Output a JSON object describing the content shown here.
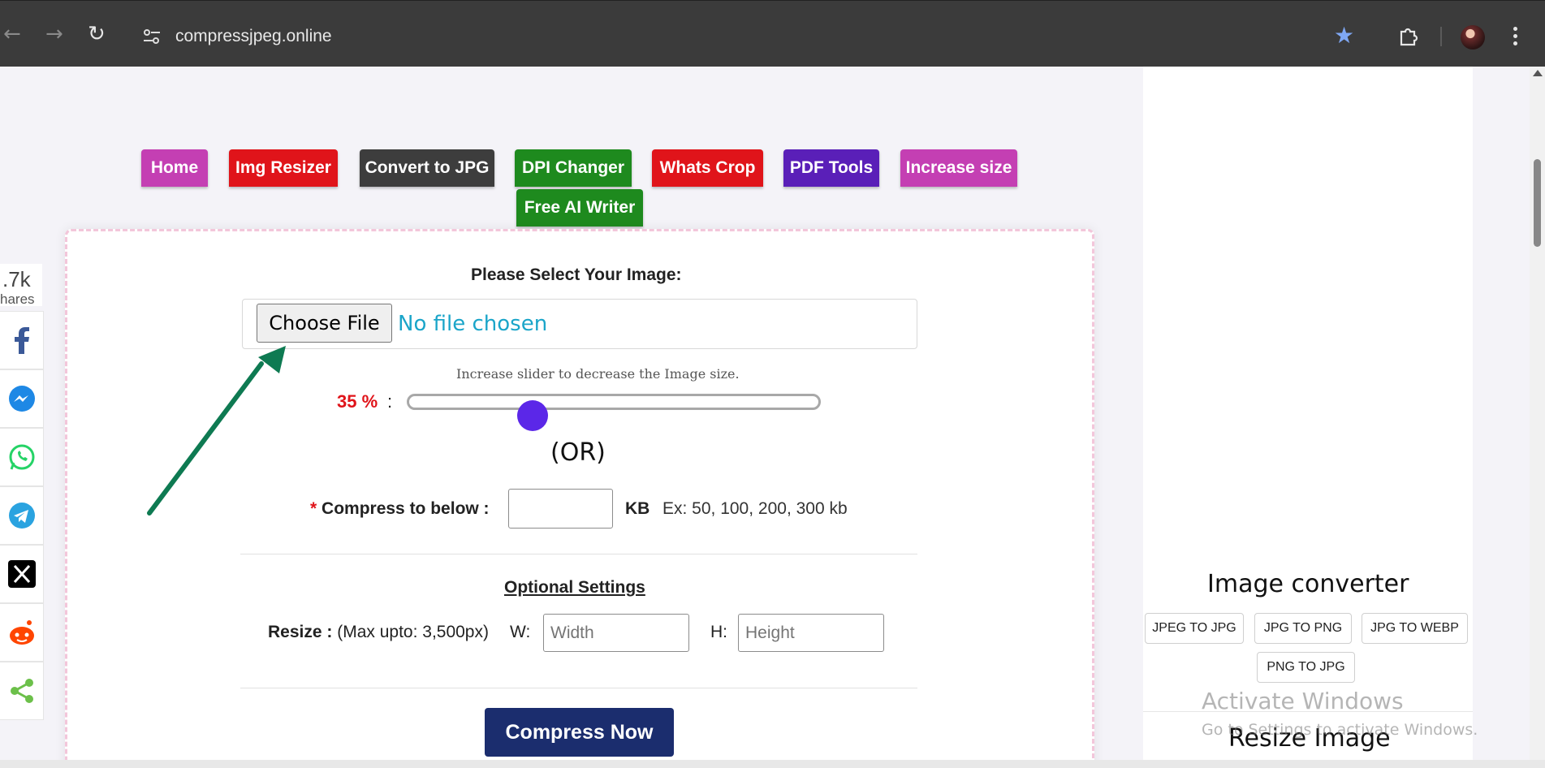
{
  "browser": {
    "url": "compressjpeg.online"
  },
  "nav": [
    {
      "label": "Home",
      "color": "#c43fb3"
    },
    {
      "label": "Img Resizer",
      "color": "#e0141a"
    },
    {
      "label": "Convert to JPG",
      "color": "#3d3d3d"
    },
    {
      "label": "DPI Changer",
      "color": "#1e8a1e"
    },
    {
      "label": "Whats Crop",
      "color": "#e0141a"
    },
    {
      "label": "PDF Tools",
      "color": "#5a1fb8"
    },
    {
      "label": "Increase size",
      "color": "#c43fb3"
    },
    {
      "label": "Free AI Writer",
      "color": "#1e8a1e"
    }
  ],
  "form": {
    "select_label": "Please Select Your Image:",
    "choose_file": "Choose File",
    "no_file": "No file chosen",
    "slider_hint": "Increase slider to decrease the Image size.",
    "slider_percent_label": "35 %",
    "slider_colon": ":",
    "slider_value": 35,
    "or_text": "(OR)",
    "compress_required": "*",
    "compress_label": "Compress to below :",
    "kb_value": "",
    "kb_unit": "KB",
    "kb_example": "Ex: 50, 100, 200, 300 kb",
    "optional_title": "Optional Settings",
    "resize_bold": "Resize :",
    "resize_note": "(Max upto: 3,500px)",
    "w_label": "W:",
    "w_placeholder": "Width",
    "h_label": "H:",
    "h_placeholder": "Height",
    "submit": "Compress Now"
  },
  "share": {
    "count": ".7k",
    "label": "hares",
    "buttons": [
      {
        "name": "facebook",
        "color": "#3b5998"
      },
      {
        "name": "messenger",
        "color": "#1e88e5"
      },
      {
        "name": "whatsapp",
        "color": "#25d366"
      },
      {
        "name": "telegram",
        "color": "#2aa3e0"
      },
      {
        "name": "x",
        "color": "#000000"
      },
      {
        "name": "reddit",
        "color": "#ff4500"
      },
      {
        "name": "share",
        "color": "#6cc04a"
      }
    ]
  },
  "sidebar": {
    "title": "Image converter",
    "links": [
      "JPEG TO JPG",
      "JPG TO PNG",
      "JPG TO WEBP",
      "PNG TO JPG"
    ],
    "next_title": "Resize Image"
  },
  "watermark": {
    "line1": "Activate Windows",
    "line2": "Go to Settings to activate Windows."
  },
  "colors": {
    "accent_blue": "#1b2d6e",
    "slider_thumb": "#5b27e8",
    "annotation_arrow": "#0e7a52"
  }
}
